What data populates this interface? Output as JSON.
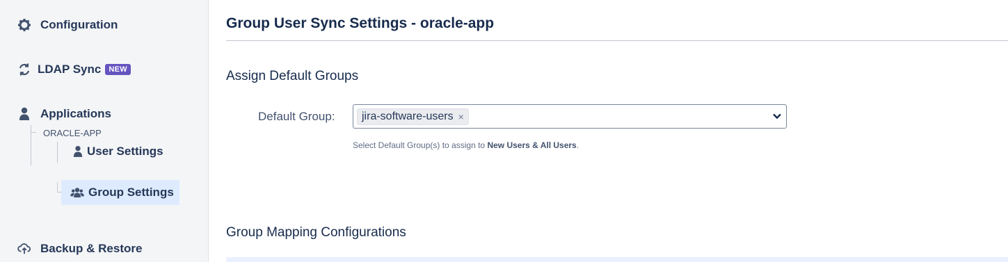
{
  "sidebar": {
    "configuration": "Configuration",
    "ldap_sync": "LDAP Sync",
    "ldap_badge": "NEW",
    "applications": "Applications",
    "app_name": "ORACLE-APP",
    "user_settings": "User Settings",
    "group_settings": "Group Settings",
    "backup_restore": "Backup & Restore"
  },
  "main": {
    "title": "Group User Sync Settings - oracle-app",
    "assign_heading": "Assign Default Groups",
    "default_group_label": "Default Group:",
    "selected_tag": "jira-software-users",
    "remove_glyph": "×",
    "help_prefix": "Select Default Group(s) to assign to ",
    "help_bold": "New Users & All Users",
    "help_suffix": ".",
    "mapping_heading": "Group Mapping Configurations"
  },
  "colors": {
    "accent": "#6554c0",
    "active_bg": "#deebff",
    "text": "#172b4d"
  },
  "icons": [
    "gear-icon",
    "sync-icon",
    "user-icon",
    "users-icon",
    "cloud-upload-icon",
    "chevron-down-icon",
    "close-icon"
  ]
}
